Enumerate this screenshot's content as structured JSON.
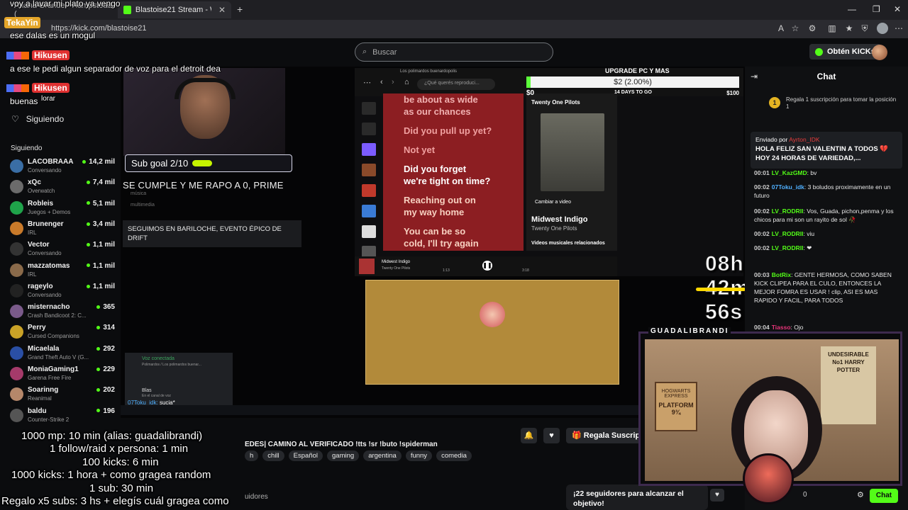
{
  "browser": {
    "tab_inactive": "Ariana Grande - Hampstead (",
    "tab_active": "Blastoise21 Stream - Watch Live o",
    "url": "https://kick.com/blastoise21"
  },
  "header": {
    "search_placeholder": "Buscar",
    "obten_label": "Obtén KICKs"
  },
  "sidebar": {
    "nav_siguiendo": "Siguiendo",
    "section_title": "Siguiendo",
    "channels": [
      {
        "name": "LACOBRAAA",
        "category": "Conversando",
        "viewers": "14,2 mil",
        "color": "#3a6ea5"
      },
      {
        "name": "xQc",
        "category": "Overwatch",
        "viewers": "7,4 mil",
        "color": "#6b6b6b"
      },
      {
        "name": "Robleis",
        "category": "Juegos + Demos",
        "viewers": "5,1 mil",
        "color": "#1fa34a"
      },
      {
        "name": "Brunenger",
        "category": "IRL",
        "viewers": "3,4 mil",
        "color": "#c97a2a"
      },
      {
        "name": "Vector",
        "category": "Conversando",
        "viewers": "1,1 mil",
        "color": "#333"
      },
      {
        "name": "mazzatomas",
        "category": "IRL",
        "viewers": "1,1 mil",
        "color": "#8a6a4a"
      },
      {
        "name": "rageylo",
        "category": "Conversando",
        "viewers": "1,1 mil",
        "color": "#222"
      },
      {
        "name": "misternacho",
        "category": "Crash Bandicoot 2: C...",
        "viewers": "365",
        "color": "#7a5a8a"
      },
      {
        "name": "Perry",
        "category": "Cursed Companions",
        "viewers": "314",
        "color": "#c9a227"
      },
      {
        "name": "Micaelala",
        "category": "Grand Theft Auto V (G...",
        "viewers": "292",
        "color": "#2a4fa5"
      },
      {
        "name": "MoniaGaming1",
        "category": "Garena Free Fire",
        "viewers": "229",
        "color": "#a53a6a"
      },
      {
        "name": "Soarinng",
        "category": "Reanimal",
        "viewers": "202",
        "color": "#b5876a"
      },
      {
        "name": "baldu",
        "category": "Counter-Strike 2",
        "viewers": "196",
        "color": "#555"
      }
    ]
  },
  "overlay_chat": {
    "line1": "voy a lavar mi plato ya vengo",
    "user1": "TekaYin",
    "line2": "ese dalas es un mogul",
    "user2": "Hikusen",
    "line3": "a ese le pedi algun separador de voz para el detroit dea",
    "user3": "Hikusen",
    "line4": "buenas",
    "line4b": "lorar"
  },
  "stream": {
    "sub_goal": "Sub goal 2/10",
    "overlay_text": "SE CUMPLE Y ME RAPO A 0, PRIME",
    "menu_musica": "música",
    "menu_multimedia": "multimedia",
    "bariloche": "SEGUIMOS EN BARILOCHE, EVENTO ÉPICO DE DRIFT",
    "spotify_title": "Los polimardos buenardopolis",
    "spotify_search": "¿Qué querés reproduci...",
    "lyrics": [
      "be about as wide",
      "as our chances",
      "Did you pull up yet?",
      "Not yet",
      "Did you forget",
      "we're tight on time?",
      "Reaching out on",
      "my way home",
      "You can be so",
      "cold, I'll try again"
    ],
    "artist": "Twenty One Pilots",
    "song": "Midwest Indigo",
    "cambiar_video": "Cambiar a video",
    "videos_rel": "Videos musicales relacionados",
    "time_cur": "1:13",
    "time_total": "3:18",
    "goal_label": "UPGRADE PC Y MAS",
    "goal_amount": "$2 (2.00%)",
    "goal_progress": 0.02,
    "goal_min": "$0",
    "goal_days": "14 DAYS TO GO",
    "goal_max": "$100",
    "timer": "08h 42m 56s",
    "voz_conectada": "Voz conectada",
    "voz_sub": "Polimardos / Los polimardos buenar...",
    "discord_user": "Blas",
    "discord_user_sub": "En el canal de voz",
    "discord_chat_user": "07Toku_idk:",
    "discord_chat_msg": "sucia*"
  },
  "rules": [
    "1000 mp: 10 min (alias: guadalibrandi)",
    "1 follow/raid x persona: 1 min",
    "100 kicks: 6 min",
    "1000 kicks: 1 hora + como gragea random",
    "1 sub: 30 min",
    "Regalo x5 subs: 3 hs + elegís cuál gragea como"
  ],
  "info": {
    "title": "EDES| CAMINO AL VERIFICADO !tts !sr !buto !spiderman",
    "tags": [
      "h",
      "chill",
      "Español",
      "gaming",
      "argentina",
      "funny",
      "comedia"
    ],
    "regala": "Regala Suscrip",
    "seguidores_card": "¡22 seguidores para alcanzar el objetivo!",
    "seguidores": "uidores"
  },
  "chat": {
    "title": "Chat",
    "sub_prompt": "Regala 1 suscripción para tomar la posición 1",
    "medal": "1",
    "pinned_by_label": "Enviado por",
    "pinned_sender": "Ayrton_IDK",
    "pinned_text": "HOLA FELIZ SAN VALENTIN A TODOS 💔 HOY 24 HORAS DE VARIEDAD,...",
    "messages": [
      {
        "time": "00:01",
        "user": "LV_KazGMD",
        "color": "#53fc18",
        "text": "bv"
      },
      {
        "time": "00:02",
        "user": "07Toku_idk",
        "color": "#4fb0ff",
        "text": "3 boludos proximamente en un futuro"
      },
      {
        "time": "00:02",
        "user": "LV_RODRII",
        "color": "#53fc18",
        "text": "Vos, Guada, pichon,penma y los chicos para mi son un rayito de sol 🥀"
      },
      {
        "time": "00:02",
        "user": "LV_RODRII",
        "color": "#53fc18",
        "text": "viu"
      },
      {
        "time": "00:02",
        "user": "LV_RODRII",
        "color": "#53fc18",
        "text": "❤"
      },
      {
        "time": "00:03",
        "user": "BotRix",
        "color": "#53fc18",
        "text": "GENTE HERMOSA, COMO SABEN KICK CLIPEA PARA EL CULO, ENTONCES LA MEJOR FOMRA ES USAR ! clip, ASI ES MAS RAPIDO Y FACIL, PARA TODOS"
      },
      {
        "time": "00:04",
        "user": "Tiasso",
        "color": "#e8357a",
        "text": "Ojo"
      }
    ],
    "count": "0",
    "chat_button": "Chat"
  },
  "cam2": {
    "label": "GUADALIBRANDI",
    "poster_text": "UNDESIRABLE No1 HARRY POTTER",
    "platform": "PLATFORM 9¾",
    "hogwarts": "HOGWARTS EXPRESS"
  }
}
